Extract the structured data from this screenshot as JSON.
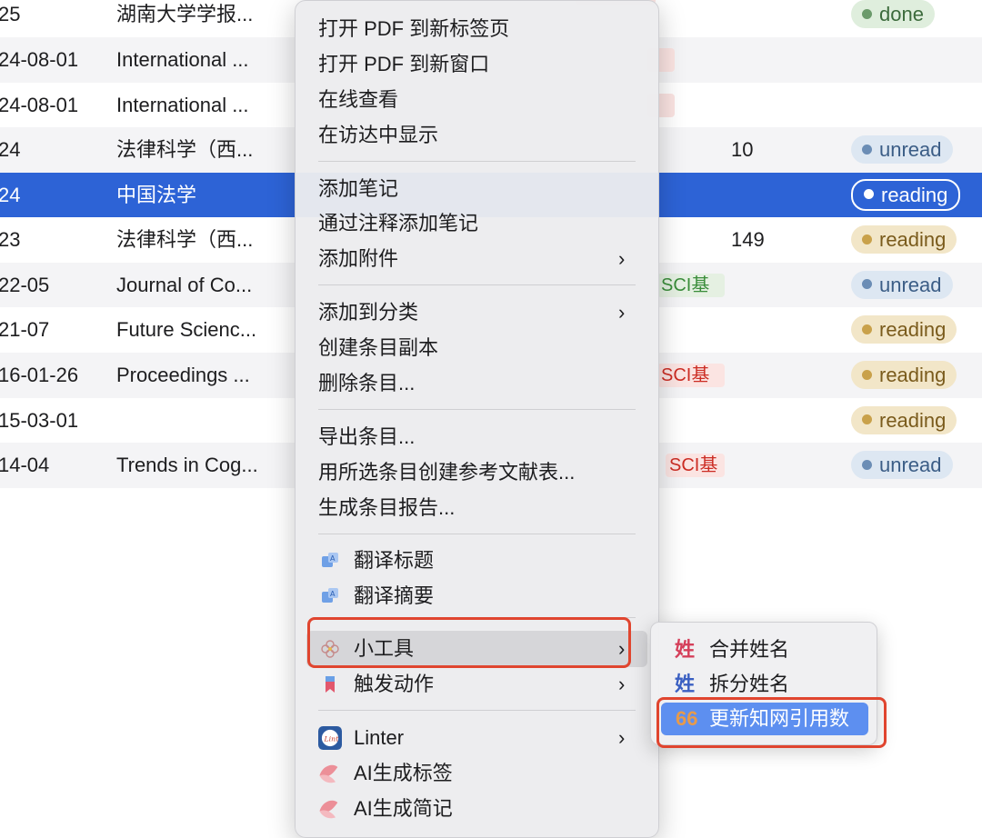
{
  "rows": [
    {
      "date": "25",
      "pub": "湖南大学学报...",
      "num": "",
      "status": "done"
    },
    {
      "date": "24-08-01",
      "pub": "International ...",
      "num": "",
      "status": ""
    },
    {
      "date": "24-08-01",
      "pub": "International ...",
      "num": "",
      "status": ""
    },
    {
      "date": "24",
      "pub": "法律科学（西...",
      "num": "10",
      "status": "unread"
    },
    {
      "date": "24",
      "pub": "中国法学",
      "num": "",
      "status": "reading"
    },
    {
      "date": "23",
      "pub": "法律科学（西...",
      "num": "149",
      "status": "reading"
    },
    {
      "date": "22-05",
      "pub": "Journal of Co...",
      "num": "",
      "status": "unread",
      "tag": "SCI基"
    },
    {
      "date": "21-07",
      "pub": "Future Scienc...",
      "num": "",
      "status": "reading"
    },
    {
      "date": "16-01-26",
      "pub": "Proceedings ...",
      "num": "",
      "status": "reading",
      "tag": "SCI基"
    },
    {
      "date": "15-03-01",
      "pub": "",
      "num": "",
      "status": "reading"
    },
    {
      "date": "14-04",
      "pub": "Trends in Cog...",
      "num": "",
      "status": "unread",
      "tag": "SCI基"
    }
  ],
  "menu": {
    "open_pdf_tab": "打开 PDF 到新标签页",
    "open_pdf_window": "打开 PDF 到新窗口",
    "view_online": "在线查看",
    "show_in_finder": "在访达中显示",
    "add_note": "添加笔记",
    "add_note_from_annotations": "通过注释添加笔记",
    "add_attachment": "添加附件",
    "add_to_collection": "添加到分类",
    "duplicate_item": "创建条目副本",
    "delete_item": "删除条目...",
    "export_item": "导出条目...",
    "create_bibliography": "用所选条目创建参考文献表...",
    "generate_report": "生成条目报告...",
    "translate_title": "翻译标题",
    "translate_abstract": "翻译摘要",
    "tools": "小工具",
    "trigger_action": "触发动作",
    "linter": "Linter",
    "ai_tags": "AI生成标签",
    "ai_summary": "AI生成简记"
  },
  "submenu": {
    "merge_names": "合并姓名",
    "split_names": "拆分姓名",
    "update_cnki_citations": "更新知网引用数",
    "name_glyph": "姓",
    "quote_glyph": "66"
  },
  "colors": {
    "selection": "#2d63d6",
    "highlight_box": "#e0452f",
    "submenu_selected": "#5d8ff0"
  }
}
